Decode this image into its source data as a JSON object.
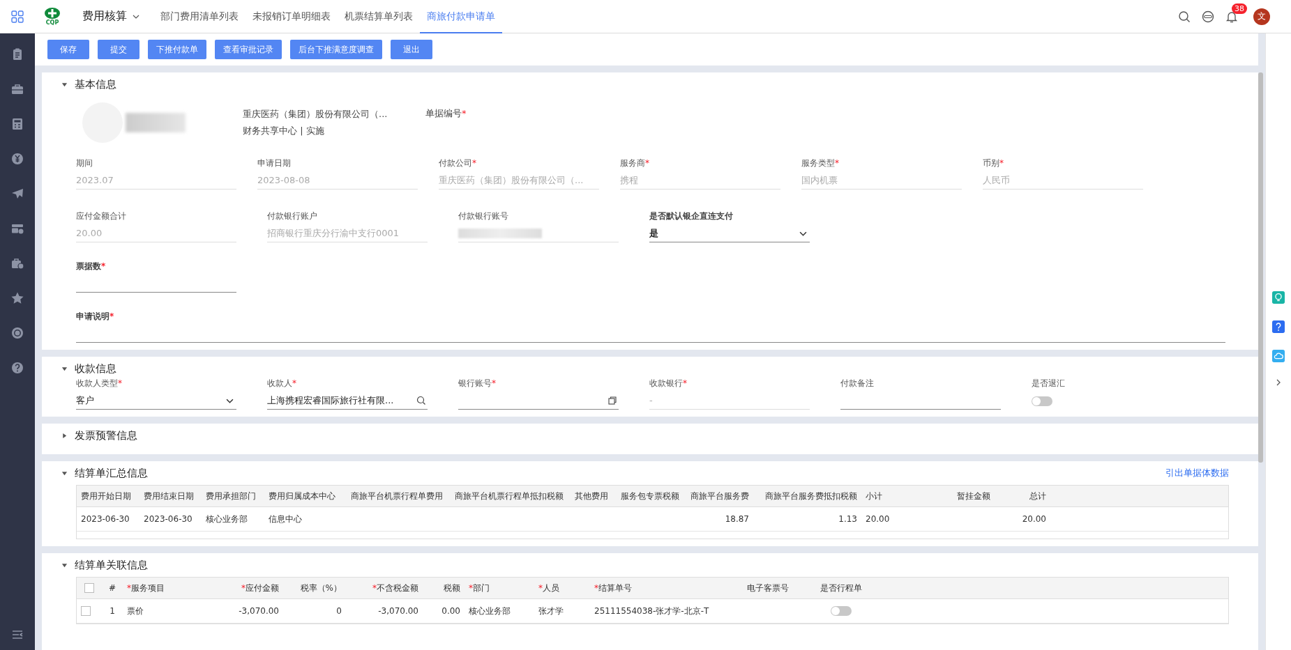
{
  "nav": {
    "app_title": "费用核算",
    "tabs": [
      {
        "label": "部门费用清单列表",
        "selected": false
      },
      {
        "label": "未报销订单明细表",
        "selected": false
      },
      {
        "label": "机票结算单列表",
        "selected": false
      },
      {
        "label": "商旅付款申请单",
        "selected": true
      }
    ],
    "logo_text": "CQP",
    "notification_count": "38",
    "avatar_text": "文"
  },
  "toolbar": [
    "保存",
    "提交",
    "下推付款单",
    "查看审批记录",
    "后台下推满意度调查",
    "退出"
  ],
  "basic_info": {
    "title": "基本信息",
    "expanded": true,
    "profile": {
      "company": "重庆医药（集团）股份有限公司（...",
      "department": "财务共享中心 | 实施",
      "doc_no_label": "单据编号",
      "doc_no_mark": "*"
    },
    "rows": [
      [
        {
          "label": "期间",
          "kind": "text",
          "readonly": true,
          "value": "2023.07"
        },
        {
          "label": "申请日期",
          "kind": "text",
          "readonly": true,
          "value": "2023-08-08"
        },
        {
          "label": "付款公司",
          "mark": "*",
          "kind": "text",
          "readonly": true,
          "value": "重庆医药（集团）股份有限公司（..."
        },
        {
          "label": "服务商",
          "mark": "*",
          "kind": "text",
          "readonly": true,
          "value": "携程"
        },
        {
          "label": "服务类型",
          "mark": "*",
          "kind": "text",
          "readonly": true,
          "value": "国内机票"
        },
        {
          "label": "币别",
          "mark": "*",
          "kind": "text",
          "readonly": true,
          "value": "人民币"
        }
      ],
      [
        {
          "label": "应付金额合计",
          "kind": "text",
          "readonly": true,
          "value": "20.00"
        },
        {
          "label": "付款银行账户",
          "kind": "text",
          "readonly": true,
          "value": "招商银行重庆分行渝中支行0001"
        },
        {
          "label": "付款银行账号",
          "kind": "redacted",
          "readonly": true
        },
        {
          "label": "是否默认银企直连支付",
          "kind": "select",
          "readonly": false,
          "value": "是"
        }
      ],
      [
        {
          "label": "票据数",
          "mark": "*",
          "kind": "empty",
          "readonly": false
        }
      ],
      [
        {
          "label": "申请说明",
          "mark": "*",
          "kind": "wide",
          "readonly": false
        }
      ]
    ]
  },
  "receipt_info": {
    "title": "收款信息",
    "expanded": true,
    "fields": [
      {
        "label": "收款人类型",
        "mark": "*",
        "kind": "select",
        "value": "客户"
      },
      {
        "label": "收款人",
        "mark": "*",
        "kind": "search",
        "value": "上海携程宏睿国际旅行社有限..."
      },
      {
        "label": "银行账号",
        "mark": "*",
        "kind": "copy"
      },
      {
        "label": "收款银行",
        "mark": "*",
        "kind": "text",
        "readonly": true,
        "value": "-"
      },
      {
        "label": "付款备注",
        "kind": "empty"
      },
      {
        "label": "是否退汇",
        "kind": "toggle",
        "on": false
      }
    ]
  },
  "invoice_warning": {
    "title": "发票预警信息",
    "expanded": false
  },
  "summary": {
    "title": "结算单汇总信息",
    "expanded": true,
    "link": "引出单据体数据",
    "columns": [
      "费用开始日期",
      "费用结束日期",
      "费用承担部门",
      "费用归属成本中心",
      "商旅平台机票行程单费用",
      "商旅平台机票行程单抵扣税额",
      "其他费用",
      "服务包专票税额",
      "商旅平台服务费",
      "商旅平台服务费抵扣税额",
      "小计",
      "暂挂金额",
      "总计"
    ],
    "rows": [
      [
        "2023-06-30",
        "2023-06-30",
        "核心业务部",
        "信息中心",
        null,
        null,
        null,
        null,
        "18.87",
        "1.13",
        "20.00",
        null,
        "20.00"
      ]
    ]
  },
  "related": {
    "title": "结算单关联信息",
    "expanded": true,
    "all_checked": false,
    "columns": [
      {
        "label": "#"
      },
      {
        "label": "服务项目",
        "mark": "*"
      },
      {
        "label": "应付金额",
        "mark": "*"
      },
      {
        "label": "税率（%）"
      },
      {
        "label": "不含税金额",
        "mark": "*"
      },
      {
        "label": "税额"
      },
      {
        "label": "部门",
        "mark": "*"
      },
      {
        "label": "人员",
        "mark": "*"
      },
      {
        "label": "结算单号",
        "mark": "*"
      },
      {
        "label": "电子客票号"
      },
      {
        "label": "是否行程单"
      }
    ],
    "rows": [
      {
        "checked": false,
        "itinerary": false,
        "cells": [
          "1",
          "票价",
          "-3,070.00",
          "0",
          "-3,070.00",
          "0.00",
          "核心业务部",
          "张才学",
          "25111554038-张才学-北京-T",
          null
        ]
      }
    ]
  }
}
